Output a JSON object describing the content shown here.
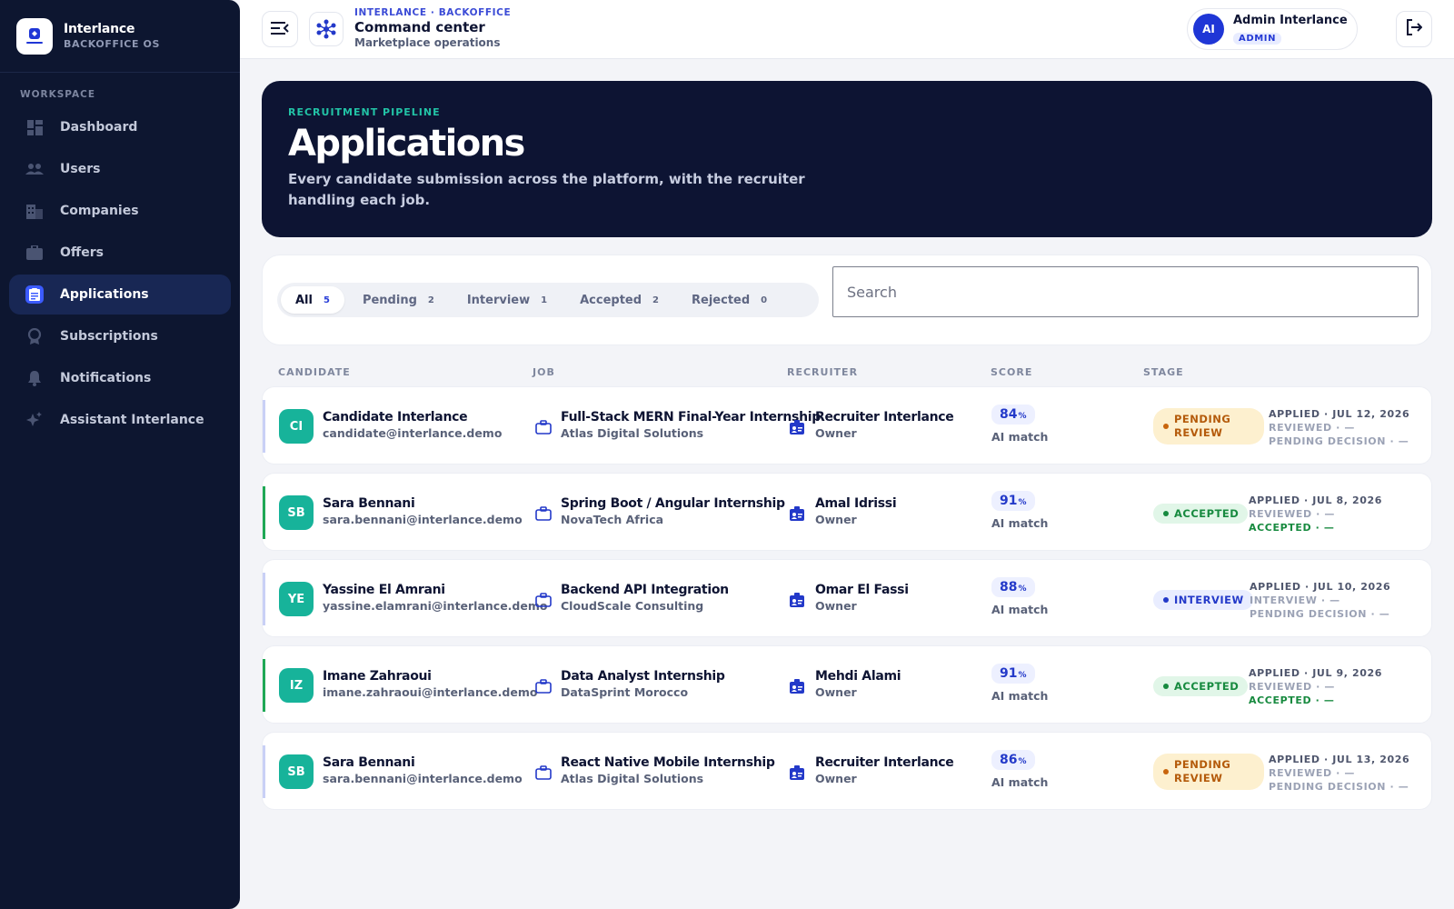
{
  "sidebar": {
    "brand_name": "Interlance",
    "brand_sub": "BACKOFFICE OS",
    "workspace_label": "WORKSPACE",
    "items": [
      {
        "label": "Dashboard",
        "icon": "dashboard-icon"
      },
      {
        "label": "Users",
        "icon": "users-icon"
      },
      {
        "label": "Companies",
        "icon": "building-icon"
      },
      {
        "label": "Offers",
        "icon": "briefcase-icon"
      },
      {
        "label": "Applications",
        "icon": "clipboard-icon",
        "active": true
      },
      {
        "label": "Subscriptions",
        "icon": "badge-icon"
      },
      {
        "label": "Notifications",
        "icon": "bell-icon"
      },
      {
        "label": "Assistant Interlance",
        "icon": "sparkle-icon"
      }
    ]
  },
  "header": {
    "kicker": "INTERLANCE · BACKOFFICE",
    "title": "Command center",
    "subtitle": "Marketplace operations",
    "user_name": "Admin Interlance",
    "user_initials": "AI",
    "user_role": "ADMIN"
  },
  "hero": {
    "kicker": "RECRUITMENT PIPELINE",
    "title": "Applications",
    "description": "Every candidate submission across the platform, with the recruiter handling each job."
  },
  "filters": {
    "tabs": [
      {
        "label": "All",
        "count": "5",
        "active": true
      },
      {
        "label": "Pending",
        "count": "2"
      },
      {
        "label": "Interview",
        "count": "1"
      },
      {
        "label": "Accepted",
        "count": "2"
      },
      {
        "label": "Rejected",
        "count": "0"
      }
    ],
    "search_placeholder": "Search",
    "search_value": ""
  },
  "table": {
    "columns": [
      "CANDIDATE",
      "JOB",
      "RECRUITER",
      "SCORE",
      "STAGE"
    ],
    "rows": [
      {
        "initials": "CI",
        "name": "Candidate Interlance",
        "email": "candidate@interlance.demo",
        "job": "Full-Stack MERN Final-Year Internship",
        "company": "Atlas Digital Solutions",
        "recruiter": "Recruiter Interlance",
        "recruiter_role": "Owner",
        "score": "84",
        "score_unit": "%",
        "score_label": "AI match",
        "stage": "PENDING REVIEW",
        "stage_type": "pending",
        "applied": "APPLIED · JUL 12, 2026",
        "step2": "REVIEWED · —",
        "step3": "PENDING DECISION · —"
      },
      {
        "initials": "SB",
        "name": "Sara Bennani",
        "email": "sara.bennani@interlance.demo",
        "job": "Spring Boot / Angular Internship",
        "company": "NovaTech Africa",
        "recruiter": "Amal Idrissi",
        "recruiter_role": "Owner",
        "score": "91",
        "score_unit": "%",
        "score_label": "AI match",
        "stage": "ACCEPTED",
        "stage_type": "accepted",
        "applied": "APPLIED · JUL 8, 2026",
        "step2": "REVIEWED · —",
        "step3": "ACCEPTED · —"
      },
      {
        "initials": "YE",
        "name": "Yassine El Amrani",
        "email": "yassine.elamrani@interlance.demo",
        "job": "Backend API Integration",
        "company": "CloudScale Consulting",
        "recruiter": "Omar El Fassi",
        "recruiter_role": "Owner",
        "score": "88",
        "score_unit": "%",
        "score_label": "AI match",
        "stage": "INTERVIEW",
        "stage_type": "interview",
        "applied": "APPLIED · JUL 10, 2026",
        "step2": "INTERVIEW · —",
        "step3": "PENDING DECISION · —"
      },
      {
        "initials": "IZ",
        "name": "Imane Zahraoui",
        "email": "imane.zahraoui@interlance.demo",
        "job": "Data Analyst Internship",
        "company": "DataSprint Morocco",
        "recruiter": "Mehdi Alami",
        "recruiter_role": "Owner",
        "score": "91",
        "score_unit": "%",
        "score_label": "AI match",
        "stage": "ACCEPTED",
        "stage_type": "accepted",
        "applied": "APPLIED · JUL 9, 2026",
        "step2": "REVIEWED · —",
        "step3": "ACCEPTED · —"
      },
      {
        "initials": "SB",
        "name": "Sara Bennani",
        "email": "sara.bennani@interlance.demo",
        "job": "React Native Mobile Internship",
        "company": "Atlas Digital Solutions",
        "recruiter": "Recruiter Interlance",
        "recruiter_role": "Owner",
        "score": "86",
        "score_unit": "%",
        "score_label": "AI match",
        "stage": "PENDING REVIEW",
        "stage_type": "pending",
        "applied": "APPLIED · JUL 13, 2026",
        "step2": "REVIEWED · —",
        "step3": "PENDING DECISION · —"
      }
    ]
  },
  "colors": {
    "sidebar_bg": "#0d1630",
    "accent": "#3b5bff",
    "hero_bg": "#0d1433",
    "teal": "#17b39a"
  }
}
